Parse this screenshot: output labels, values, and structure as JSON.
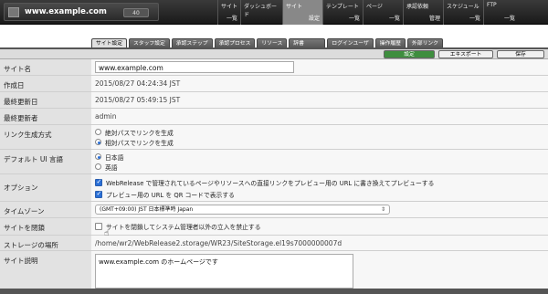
{
  "header": {
    "site_name": "www.example.com",
    "badge": "40",
    "nav": [
      {
        "top": "サイト",
        "bottom": "一覧"
      },
      {
        "top": "ダッシュボード",
        "bottom": ""
      },
      {
        "top": "サイト",
        "bottom": "設定"
      },
      {
        "top": "テンプレート",
        "bottom": "一覧"
      },
      {
        "top": "ページ",
        "bottom": "一覧"
      },
      {
        "top": "承認依頼",
        "bottom": "管理"
      },
      {
        "top": "スケジュール",
        "bottom": "一覧"
      },
      {
        "top": "FTP",
        "bottom": "一覧"
      }
    ]
  },
  "tabs": [
    "サイト設定",
    "スタッフ設定",
    "承認ステップ",
    "承認プロセス",
    "リソース",
    "辞書",
    "ログインユーザ",
    "操作履歴",
    "外部リンク"
  ],
  "actions": {
    "save_draft": "設定",
    "export": "エキスポート",
    "save": "保存"
  },
  "form": {
    "site_name_label": "サイト名",
    "site_name_value": "www.example.com",
    "created_label": "作成日",
    "created_value": "2015/08/27 04:24:34 JST",
    "updated_label": "最終更新日",
    "updated_value": "2015/08/27 05:49:15 JST",
    "updater_label": "最終更新者",
    "updater_value": "admin",
    "link_label": "リンク生成方式",
    "link_opt1": "絶対パスでリンクを生成",
    "link_opt2": "相対パスでリンクを生成",
    "lang_label": "デフォルト UI 言語",
    "lang_opt1": "日本語",
    "lang_opt2": "英語",
    "options_label": "オプション",
    "option1": "WebRelease で管理されているページやリソースへの直接リンクをプレビュー用の URL に書き換えてプレビューする",
    "option2": "プレビュー用の URL を QR コードで表示する",
    "tz_label": "タイムゾーン",
    "tz_value": "(GMT+09:00) JST 日本標準時 Japan",
    "close_label": "サイトを閉鎖",
    "close_option": "サイトを閉鎖してシステム管理者以外の立入を禁止する",
    "storage_label": "ストレージの場所",
    "storage_value": "/home/wr2/WebRelease2.storage/WR23/SiteStorage.el19s7000000007d",
    "desc_label": "サイト説明",
    "desc_value": "www.example.com のホームページです"
  }
}
